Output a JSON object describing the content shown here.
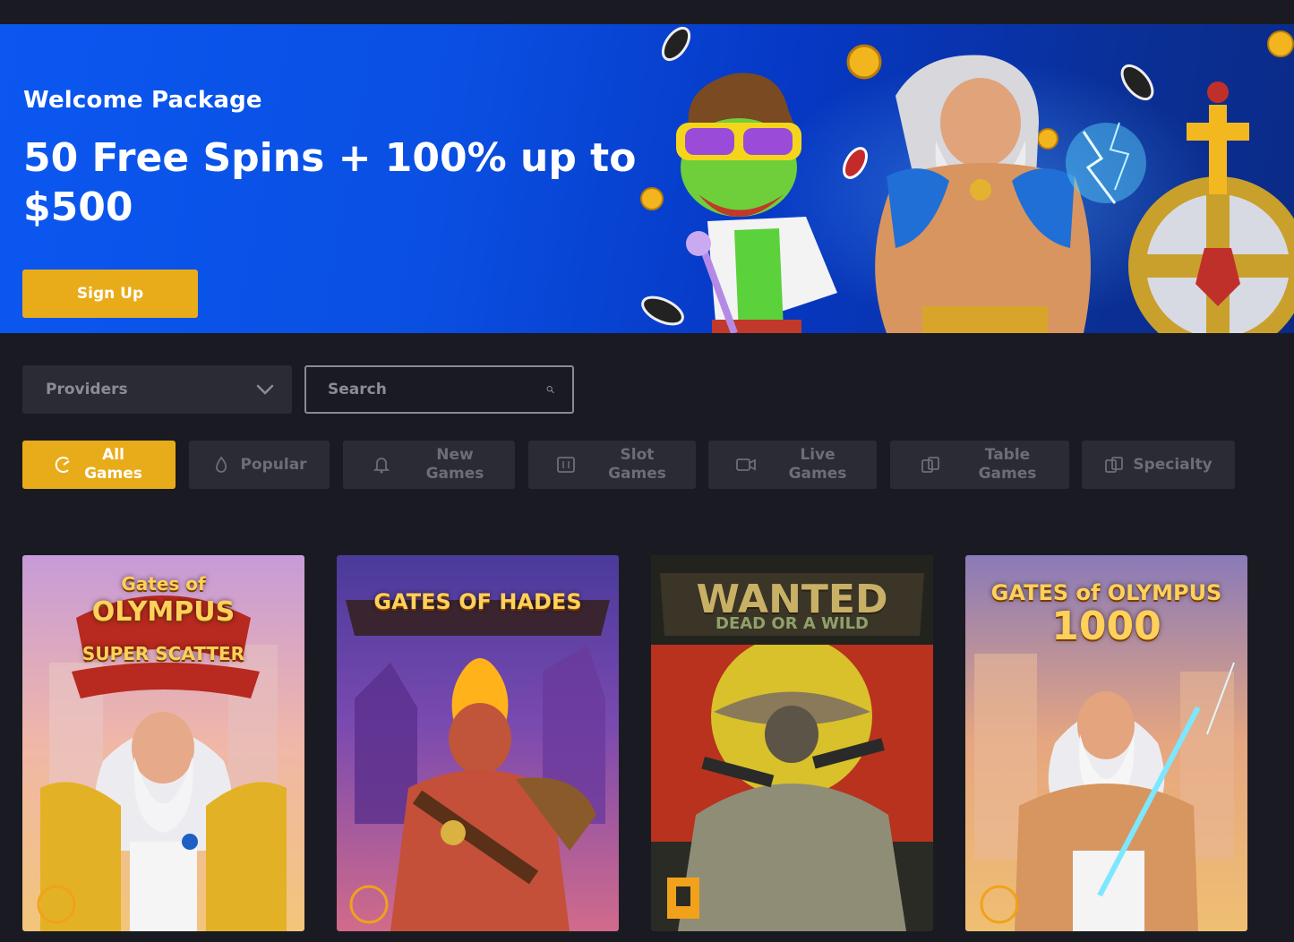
{
  "banner": {
    "welcome": "Welcome Package",
    "headline": "50 Free Spins + 100% up to $500",
    "signup_label": "Sign Up"
  },
  "filters": {
    "providers_label": "Providers",
    "search_placeholder": "Search"
  },
  "tabs": [
    {
      "label": "All Games",
      "icon": "all-games-icon",
      "active": true
    },
    {
      "label": "Popular",
      "icon": "flame-icon",
      "active": false
    },
    {
      "label": "New Games",
      "icon": "bell-icon",
      "active": false
    },
    {
      "label": "Slot Games",
      "icon": "slot-machine-icon",
      "active": false
    },
    {
      "label": "Live Games",
      "icon": "video-camera-icon",
      "active": false
    },
    {
      "label": "Table Games",
      "icon": "cards-icon",
      "active": false
    },
    {
      "label": "Specialty",
      "icon": "cards-icon",
      "active": false
    }
  ],
  "games": [
    {
      "title_top": "Gates of",
      "title_main": "OLYMPUS",
      "title_sub": "SUPER SCATTER",
      "provider_icon": "pragmatic-play-icon"
    },
    {
      "title_main": "GATES OF HADES",
      "provider_icon": "pragmatic-play-icon"
    },
    {
      "title_main": "WANTED",
      "title_sub": "DEAD OR A WILD",
      "provider_icon": "hacksaw-icon"
    },
    {
      "title_main": "GATES of OLYMPUS",
      "title_sub": "1000",
      "provider_icon": "pragmatic-play-icon"
    }
  ],
  "colors": {
    "accent": "#e8ac1a",
    "background": "#1a1b22",
    "panel": "#2a2b33",
    "banner_blue": "#0b57f0"
  }
}
